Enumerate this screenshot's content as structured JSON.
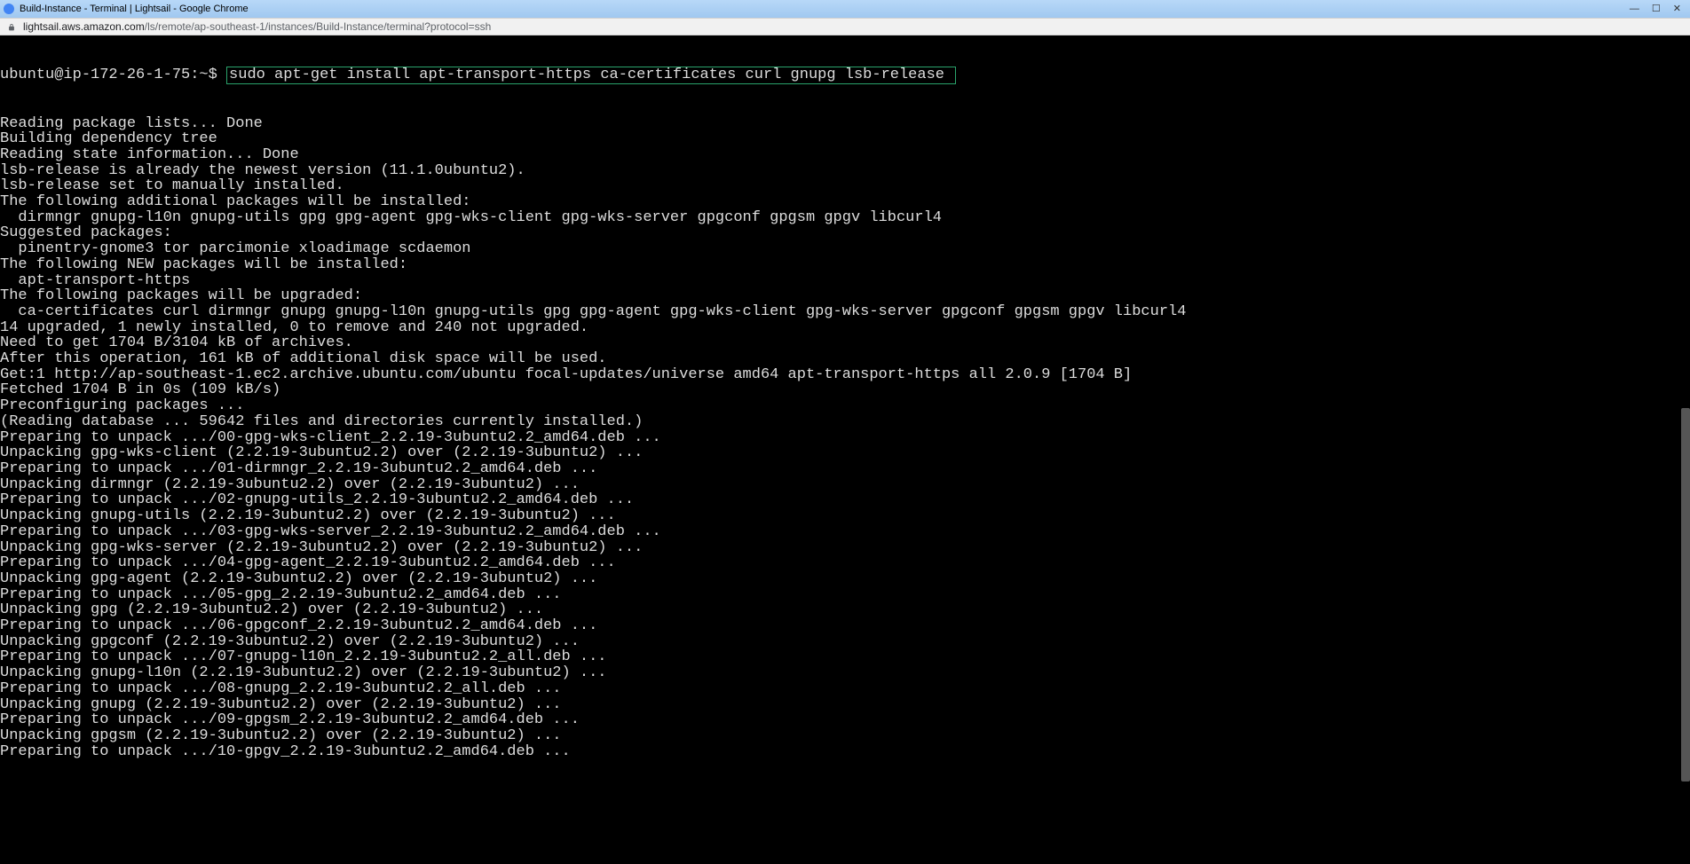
{
  "window": {
    "title": "Build-Instance - Terminal | Lightsail - Google Chrome"
  },
  "address": {
    "domain": "lightsail.aws.amazon.com",
    "path": "/ls/remote/ap-southeast-1/instances/Build-Instance/terminal?protocol=ssh"
  },
  "terminal": {
    "prompt": "ubuntu@ip-172-26-1-75:~$ ",
    "command": "sudo apt-get install apt-transport-https ca-certificates curl gnupg lsb-release ",
    "lines": [
      "Reading package lists... Done",
      "Building dependency tree",
      "Reading state information... Done",
      "lsb-release is already the newest version (11.1.0ubuntu2).",
      "lsb-release set to manually installed.",
      "The following additional packages will be installed:",
      "  dirmngr gnupg-l10n gnupg-utils gpg gpg-agent gpg-wks-client gpg-wks-server gpgconf gpgsm gpgv libcurl4",
      "Suggested packages:",
      "  pinentry-gnome3 tor parcimonie xloadimage scdaemon",
      "The following NEW packages will be installed:",
      "  apt-transport-https",
      "The following packages will be upgraded:",
      "  ca-certificates curl dirmngr gnupg gnupg-l10n gnupg-utils gpg gpg-agent gpg-wks-client gpg-wks-server gpgconf gpgsm gpgv libcurl4",
      "14 upgraded, 1 newly installed, 0 to remove and 240 not upgraded.",
      "Need to get 1704 B/3104 kB of archives.",
      "After this operation, 161 kB of additional disk space will be used.",
      "Get:1 http://ap-southeast-1.ec2.archive.ubuntu.com/ubuntu focal-updates/universe amd64 apt-transport-https all 2.0.9 [1704 B]",
      "Fetched 1704 B in 0s (109 kB/s)",
      "Preconfiguring packages ...",
      "(Reading database ... 59642 files and directories currently installed.)",
      "Preparing to unpack .../00-gpg-wks-client_2.2.19-3ubuntu2.2_amd64.deb ...",
      "Unpacking gpg-wks-client (2.2.19-3ubuntu2.2) over (2.2.19-3ubuntu2) ...",
      "Preparing to unpack .../01-dirmngr_2.2.19-3ubuntu2.2_amd64.deb ...",
      "Unpacking dirmngr (2.2.19-3ubuntu2.2) over (2.2.19-3ubuntu2) ...",
      "Preparing to unpack .../02-gnupg-utils_2.2.19-3ubuntu2.2_amd64.deb ...",
      "Unpacking gnupg-utils (2.2.19-3ubuntu2.2) over (2.2.19-3ubuntu2) ...",
      "Preparing to unpack .../03-gpg-wks-server_2.2.19-3ubuntu2.2_amd64.deb ...",
      "Unpacking gpg-wks-server (2.2.19-3ubuntu2.2) over (2.2.19-3ubuntu2) ...",
      "Preparing to unpack .../04-gpg-agent_2.2.19-3ubuntu2.2_amd64.deb ...",
      "Unpacking gpg-agent (2.2.19-3ubuntu2.2) over (2.2.19-3ubuntu2) ...",
      "Preparing to unpack .../05-gpg_2.2.19-3ubuntu2.2_amd64.deb ...",
      "Unpacking gpg (2.2.19-3ubuntu2.2) over (2.2.19-3ubuntu2) ...",
      "Preparing to unpack .../06-gpgconf_2.2.19-3ubuntu2.2_amd64.deb ...",
      "Unpacking gpgconf (2.2.19-3ubuntu2.2) over (2.2.19-3ubuntu2) ...",
      "Preparing to unpack .../07-gnupg-l10n_2.2.19-3ubuntu2.2_all.deb ...",
      "Unpacking gnupg-l10n (2.2.19-3ubuntu2.2) over (2.2.19-3ubuntu2) ...",
      "Preparing to unpack .../08-gnupg_2.2.19-3ubuntu2.2_all.deb ...",
      "Unpacking gnupg (2.2.19-3ubuntu2.2) over (2.2.19-3ubuntu2) ...",
      "Preparing to unpack .../09-gpgsm_2.2.19-3ubuntu2.2_amd64.deb ...",
      "Unpacking gpgsm (2.2.19-3ubuntu2.2) over (2.2.19-3ubuntu2) ...",
      "Preparing to unpack .../10-gpgv_2.2.19-3ubuntu2.2_amd64.deb ..."
    ]
  },
  "scroll": {
    "thumb_top_pct": 45,
    "thumb_height_pct": 45
  }
}
